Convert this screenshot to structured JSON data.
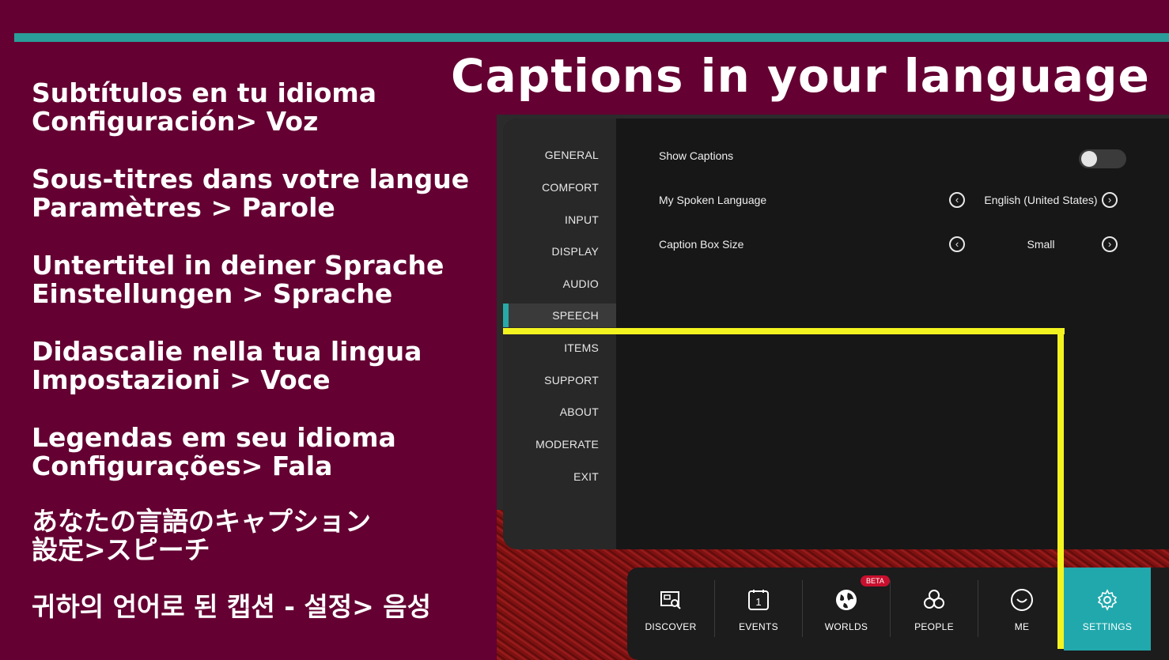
{
  "slide": {
    "title": "Captions in your language",
    "languages": [
      {
        "line1": "Subtítulos en tu idioma",
        "line2": "Configuración> Voz"
      },
      {
        "line1": "Sous-titres dans votre langue",
        "line2": "Paramètres > Parole"
      },
      {
        "line1": "Untertitel in deiner Sprache",
        "line2": "Einstellungen > Sprache"
      },
      {
        "line1": "Didascalie nella tua lingua",
        "line2": "Impostazioni > Voce"
      },
      {
        "line1": "Legendas em seu idioma",
        "line2": "Configurações> Fala"
      },
      {
        "line1": "あなたの言語のキャプション",
        "line2": "設定>スピーチ"
      },
      {
        "line1": "귀하의 언어로 된 캡션 - 설정> 음성",
        "line2": ""
      }
    ]
  },
  "settings": {
    "nav": [
      "GENERAL",
      "COMFORT",
      "INPUT",
      "DISPLAY",
      "AUDIO",
      "SPEECH",
      "ITEMS",
      "SUPPORT",
      "ABOUT",
      "MODERATE",
      "EXIT"
    ],
    "selected": "SPEECH",
    "rows": {
      "show_captions": {
        "label": "Show Captions",
        "value": false
      },
      "spoken_language": {
        "label": "My Spoken Language",
        "value": "English (United States)"
      },
      "caption_box_size": {
        "label": "Caption Box Size",
        "value": "Small"
      }
    }
  },
  "dock": {
    "items": [
      {
        "label": "DISCOVER",
        "icon": "discover-icon"
      },
      {
        "label": "EVENTS",
        "icon": "calendar-icon",
        "icon_text": "1"
      },
      {
        "label": "WORLDS",
        "icon": "globe-icon",
        "badge": "BETA"
      },
      {
        "label": "PEOPLE",
        "icon": "people-icon"
      },
      {
        "label": "ME",
        "icon": "smiley-icon"
      },
      {
        "label": "SETTINGS",
        "icon": "gear-icon"
      }
    ],
    "active": "SETTINGS"
  },
  "colors": {
    "background": "#640032",
    "accent_bar": "#2a9d9a",
    "settings_active": "#21a8ac",
    "highlight": "#f3f320",
    "beta_badge": "#c8102e"
  }
}
